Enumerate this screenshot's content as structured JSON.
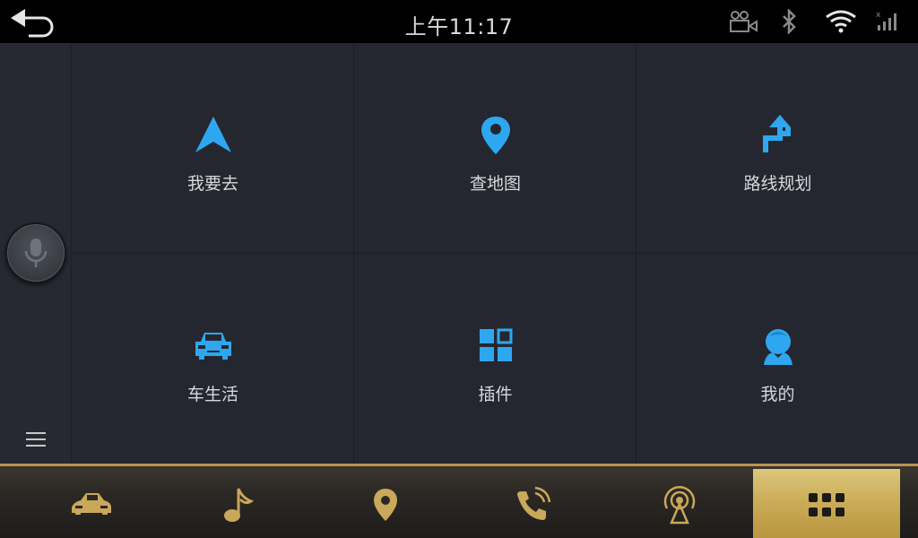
{
  "status_bar": {
    "time": "上午11:17",
    "icons": [
      "back-arrow-icon",
      "camera-icon",
      "bluetooth-icon",
      "wifi-icon",
      "cellular-signal-icon"
    ]
  },
  "sidebar": {
    "icons": [
      "microphone-icon",
      "hamburger-menu-icon"
    ]
  },
  "tiles": [
    {
      "label": "我要去",
      "icon": "navigation-arrow-icon"
    },
    {
      "label": "查地图",
      "icon": "map-pin-icon"
    },
    {
      "label": "路线规划",
      "icon": "route-turn-icon"
    },
    {
      "label": "车生活",
      "icon": "car-icon"
    },
    {
      "label": "插件",
      "icon": "plugin-grid-icon"
    },
    {
      "label": "我的",
      "icon": "profile-icon"
    }
  ],
  "dock": {
    "items": [
      "car-icon",
      "music-note-icon",
      "map-pin-icon",
      "phone-icon",
      "radio-antenna-icon",
      "apps-grid-icon"
    ],
    "active_index": 5
  },
  "colors": {
    "accent_blue": "#2ea7f0",
    "gold": "#c9aa55",
    "panel_bg": "#24272f"
  }
}
